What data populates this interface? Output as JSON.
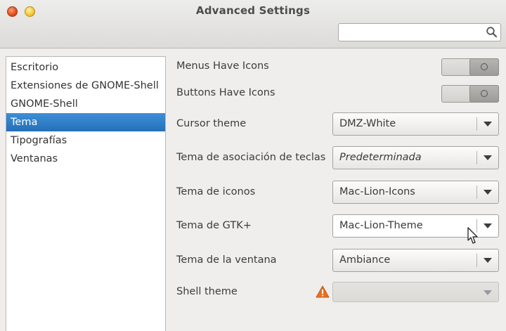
{
  "window": {
    "title": "Advanced Settings",
    "buttons": [
      "close-icon",
      "minimize-icon"
    ]
  },
  "search": {
    "value": "",
    "placeholder": "",
    "icon": "search-icon"
  },
  "sidebar": {
    "items": [
      {
        "label": "Escritorio",
        "selected": false
      },
      {
        "label": "Extensiones de GNOME-Shell",
        "selected": false
      },
      {
        "label": "GNOME-Shell",
        "selected": false
      },
      {
        "label": "Tema",
        "selected": true
      },
      {
        "label": "Tipografías",
        "selected": false
      },
      {
        "label": "Ventanas",
        "selected": false
      }
    ]
  },
  "settings": {
    "menus_icons": {
      "label": "Menus Have Icons",
      "state": "off"
    },
    "buttons_icons": {
      "label": "Buttons Have Icons",
      "state": "off"
    },
    "cursor_theme": {
      "label": "Cursor theme",
      "value": "DMZ-White"
    },
    "keybinding_theme": {
      "label": "Tema de asociación de teclas",
      "value": "Predeterminada"
    },
    "icon_theme": {
      "label": "Tema de iconos",
      "value": "Mac-Lion-Icons"
    },
    "gtk_theme": {
      "label": "Tema de GTK+",
      "value": "Mac-Lion-Theme"
    },
    "window_theme": {
      "label": "Tema de la ventana",
      "value": "Ambiance"
    },
    "shell_theme": {
      "label": "Shell theme",
      "value": "",
      "warning_icon": "warning-icon",
      "disabled": true
    }
  },
  "colors": {
    "selection": "#2f7fc8",
    "close_button": "#df4b16",
    "minimize_button": "#f6c42f",
    "warning": "#e8711f"
  }
}
